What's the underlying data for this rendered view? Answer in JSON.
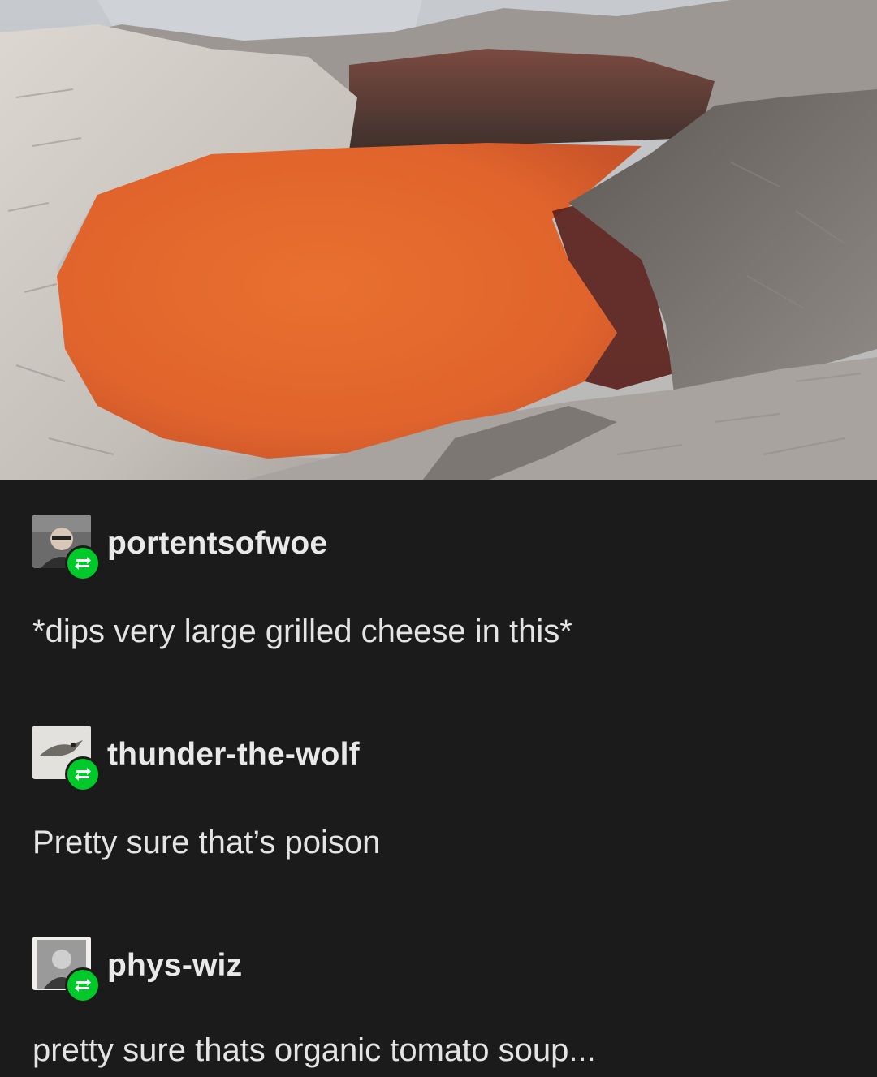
{
  "image": {
    "subject": "red-orange crater lake",
    "colors": {
      "lake": "#e0662f",
      "lake_shadow": "#5a1f1a",
      "rock_light": "#d6d1cb",
      "rock_dark": "#6e6965",
      "water_bg": "#c9ccd0"
    }
  },
  "posts": [
    {
      "username": "portentsofwoe",
      "text": "*dips very large grilled cheese in this*",
      "avatar_icon": "person-photo"
    },
    {
      "username": "thunder-the-wolf",
      "text": "Pretty sure that’s poison",
      "avatar_icon": "bird-photo"
    },
    {
      "username": "phys-wiz",
      "text": "pretty sure thats organic tomato soup...",
      "avatar_icon": "person-photo"
    }
  ],
  "theme": {
    "background": "#1b1b1b",
    "text": "#e4e4e4",
    "reblog_accent": "#00c92a"
  }
}
